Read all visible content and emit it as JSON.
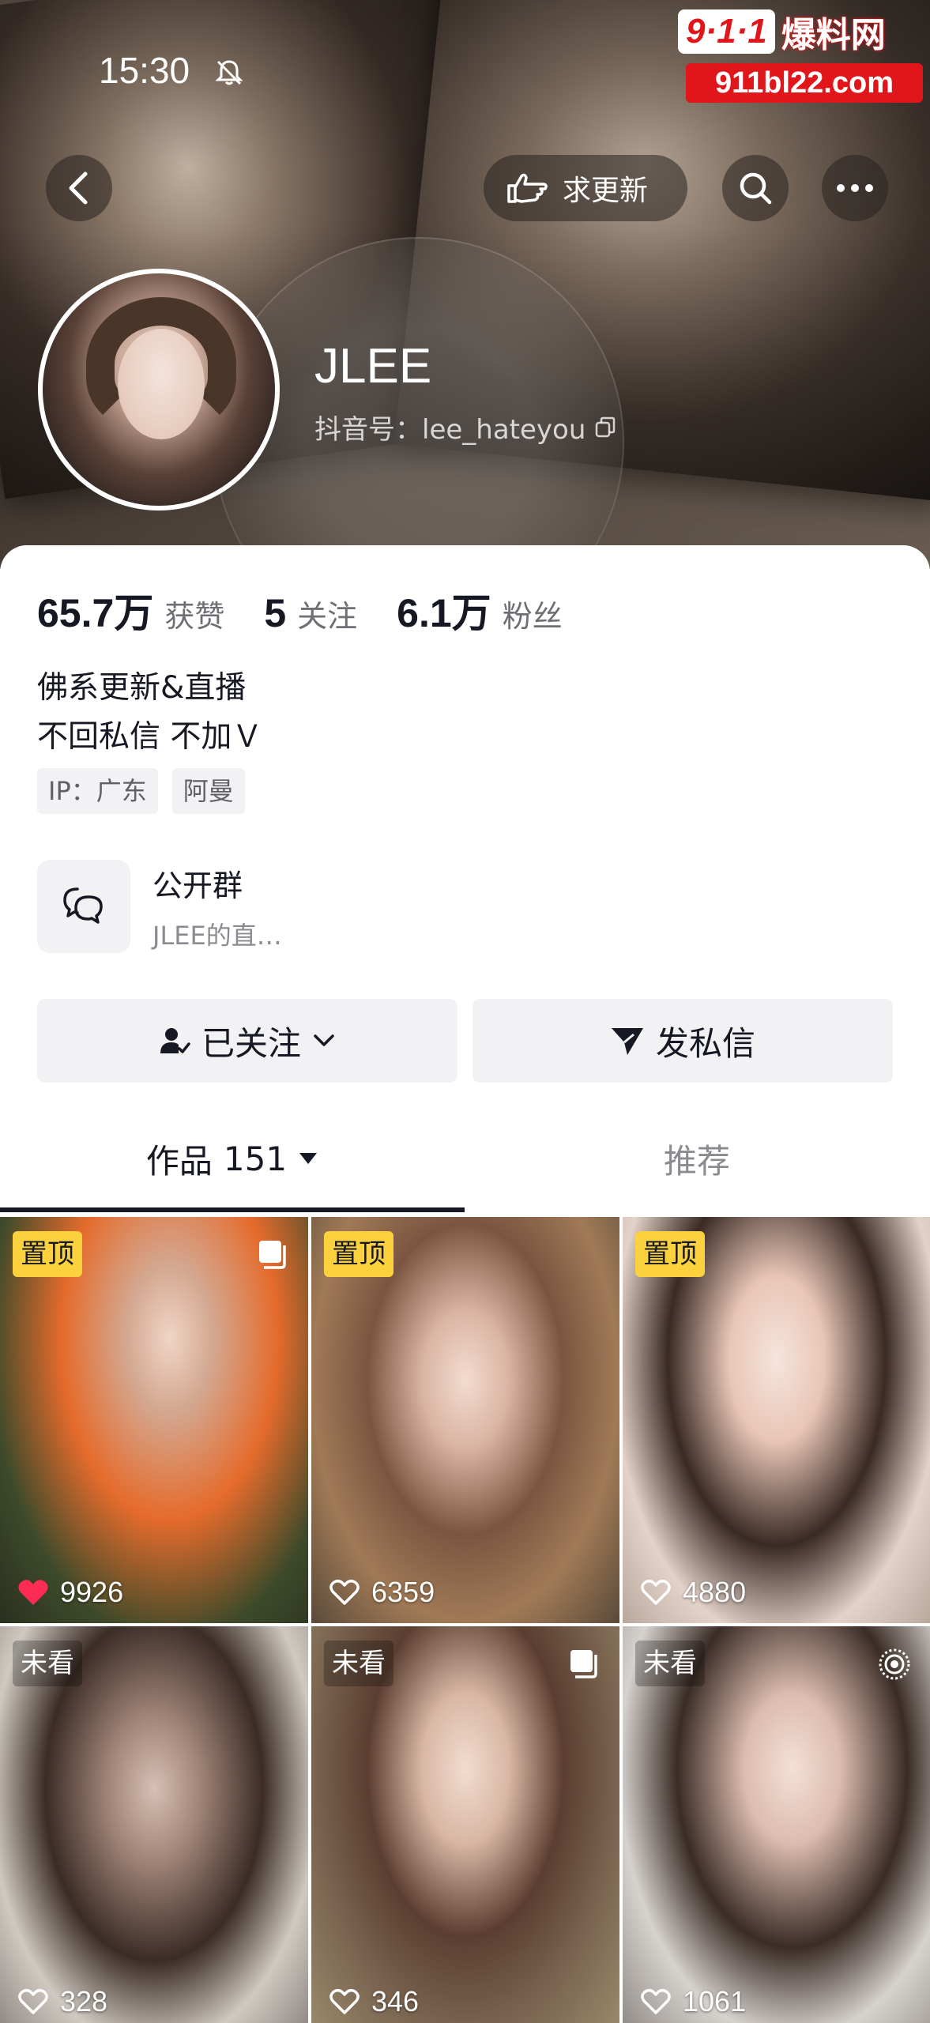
{
  "status_bar": {
    "time": "15:30"
  },
  "watermark": {
    "logo": "9·1·1",
    "name": "爆料网",
    "url": "911bl22.com"
  },
  "header_nav": {
    "request_update_label": "求更新"
  },
  "profile": {
    "name": "JLEE",
    "douyin_id": "抖音号：lee_hateyou"
  },
  "stats": [
    {
      "value": "65.7万",
      "label": "获赞"
    },
    {
      "value": "5",
      "label": "关注"
    },
    {
      "value": "6.1万",
      "label": "粉丝"
    }
  ],
  "bio": {
    "line1": "佛系更新&直播",
    "line2": "不回私信 不加Ｖ"
  },
  "tags": [
    "IP：广东",
    "阿曼"
  ],
  "group": {
    "title": "公开群",
    "subtitle": "JLEE的直…"
  },
  "actions": {
    "follow_label": "已关注",
    "message_label": "发私信"
  },
  "tabs": {
    "works_label": "作品",
    "works_count": "151",
    "recommend_label": "推荐"
  },
  "grid": [
    {
      "badge": "置顶",
      "badge_type": "pinned",
      "likes": "9926",
      "liked": true,
      "corner": "multi-photo-icon"
    },
    {
      "badge": "置顶",
      "badge_type": "pinned",
      "likes": "6359",
      "liked": false,
      "corner": ""
    },
    {
      "badge": "置顶",
      "badge_type": "pinned",
      "likes": "4880",
      "liked": false,
      "corner": ""
    },
    {
      "badge": "未看",
      "badge_type": "unseen",
      "likes": "328",
      "liked": false,
      "corner": ""
    },
    {
      "badge": "未看",
      "badge_type": "unseen",
      "likes": "346",
      "liked": false,
      "corner": "multi-photo-icon"
    },
    {
      "badge": "未看",
      "badge_type": "unseen",
      "likes": "1061",
      "liked": false,
      "corner": "live-photo-icon"
    }
  ],
  "colors": {
    "pinned_badge": "#fbd13d",
    "liked_heart": "#fe2c55",
    "text_primary": "#161823",
    "text_secondary": "#6e6f75"
  }
}
